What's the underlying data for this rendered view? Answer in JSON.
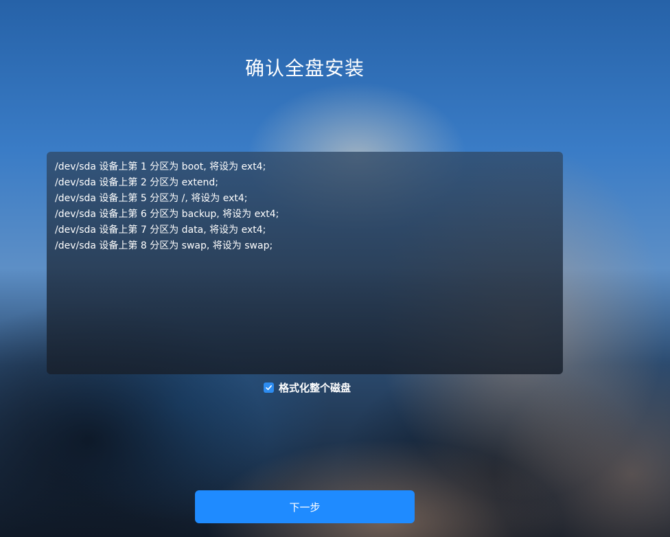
{
  "page": {
    "title": "确认全盘安装"
  },
  "partition_info": {
    "lines": [
      "/dev/sda 设备上第 1 分区为 boot, 将设为 ext4;",
      "/dev/sda 设备上第 2 分区为 extend;",
      "/dev/sda 设备上第 5 分区为 /, 将设为 ext4;",
      "/dev/sda 设备上第 6 分区为 backup, 将设为 ext4;",
      "/dev/sda 设备上第 7 分区为 data, 将设为 ext4;",
      "/dev/sda 设备上第 8 分区为 swap, 将设为 swap;"
    ]
  },
  "format_option": {
    "label": "格式化整个磁盘",
    "checked": true,
    "icon": "checkmark-icon"
  },
  "actions": {
    "next_label": "下一步"
  },
  "colors": {
    "accent": "#1f8bff",
    "checkbox": "#2d8cf0"
  }
}
